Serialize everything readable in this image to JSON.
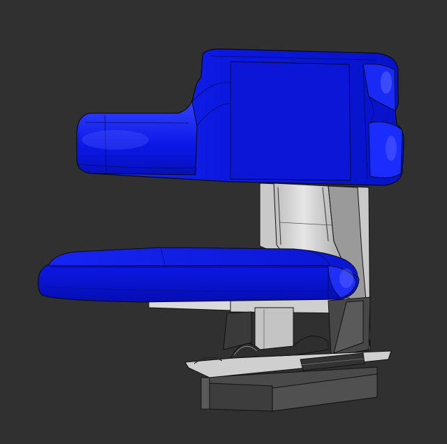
{
  "scene": {
    "subject": "tractor-seat-cad-model",
    "colors": {
      "background": "#303030",
      "cushion_blue": "#0a17e6",
      "cushion_blue_dark": "#0510a8",
      "cushion_blue_light": "#3c4cff",
      "bracket_light": "#d6d6d6",
      "bracket_mid": "#a9a9a9",
      "bracket_dark": "#5a5a5a",
      "rail_dark": "#3c3c3c",
      "edge_line": "#0a0a0a"
    }
  }
}
